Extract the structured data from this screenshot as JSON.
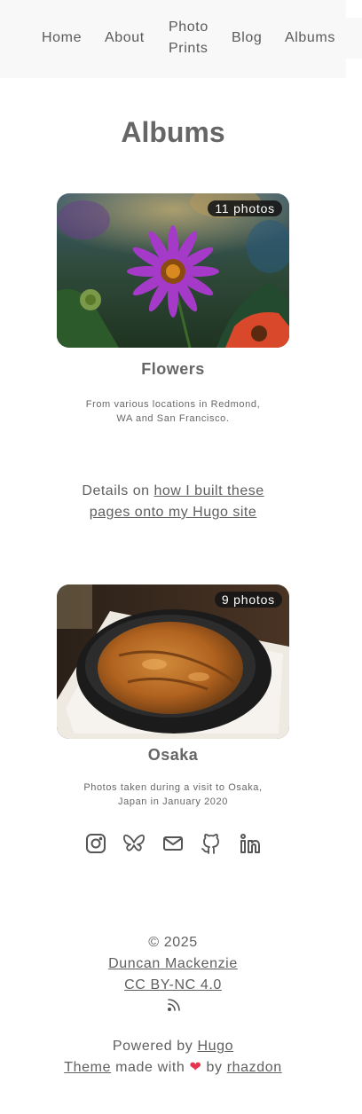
{
  "nav": {
    "home": "Home",
    "about": "About",
    "photo_prints_line1": "Photo",
    "photo_prints_line2": "Prints",
    "blog": "Blog",
    "albums": "Albums"
  },
  "page": {
    "title": "Albums"
  },
  "albums": [
    {
      "name": "Flowers",
      "count": "11 photos",
      "desc_line1": "From various locations in Redmond,",
      "desc_line2": "WA and San Francisco."
    },
    {
      "name": "Osaka",
      "count": "9 photos",
      "desc_line1": "Photos taken during a visit to Osaka,",
      "desc_line2": "Japan in January 2020"
    }
  ],
  "details": {
    "prefix": "Details on ",
    "link_line1": "how I built these",
    "link_line2": "pages onto my Hugo site"
  },
  "social": [
    "instagram-icon",
    "bluesky-icon",
    "email-icon",
    "github-icon",
    "linkedin-icon"
  ],
  "footer": {
    "copyright": "© 2025",
    "author": "Duncan Mackenzie",
    "license": "CC BY-NC 4.0",
    "powered_prefix": "Powered by ",
    "powered_link": "Hugo",
    "theme_link": "Theme",
    "made_with": " made with ",
    "heart": "❤",
    "by": " by ",
    "theme_author": "rhazdon"
  },
  "colors": {
    "text": "#5f5f5f",
    "topbar": "#f8f8f8",
    "heart": "#e8334e",
    "badge": "#141414"
  }
}
